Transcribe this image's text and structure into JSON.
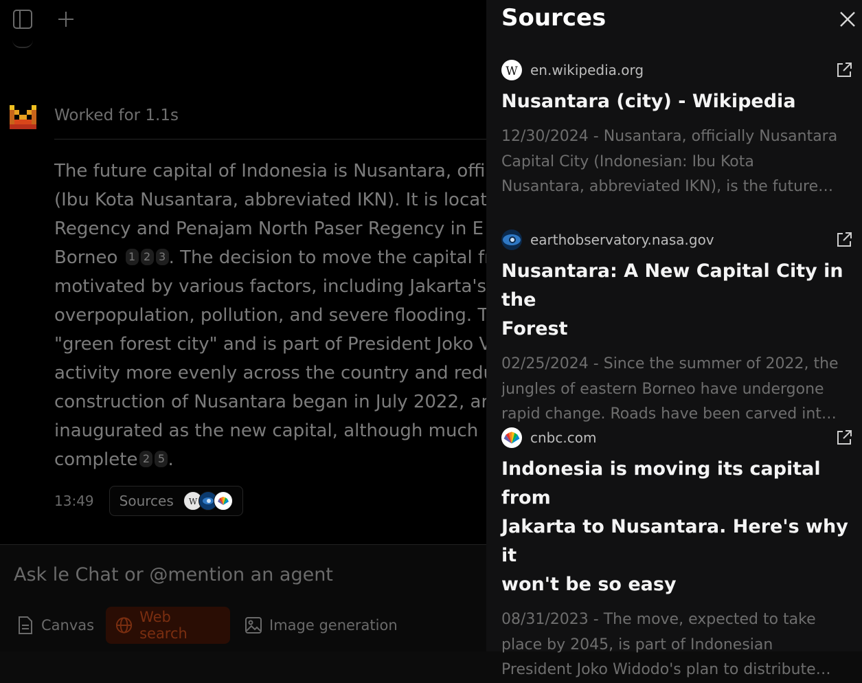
{
  "composer": {
    "placeholder": "Ask le Chat or @mention an agent",
    "tools": [
      {
        "label": "Canvas",
        "icon": "document-icon"
      },
      {
        "label": "Web search",
        "icon": "globe-icon",
        "active": true
      },
      {
        "label": "Image generation",
        "icon": "image-icon"
      }
    ]
  },
  "message": {
    "status": "Worked for 1.1s",
    "lines": [
      "The future capital of Indonesia is Nusantara, offi",
      "(Ibu Kota Nusantara, abbreviated IKN). It is locat",
      "Regency and Penajam North Paser Regency in E",
      "Borneo",
      ". The decision to move the capital fr",
      "motivated by various factors, including Jakarta's",
      "overpopulation, pollution, and severe flooding. T",
      "\"green forest city\" and is part of President Joko V",
      "activity more evenly across the country and redu",
      "construction of Nusantara began in July 2022, ar",
      "inaugurated as the new capital, although much",
      "complete",
      "."
    ],
    "citations_a": [
      "1",
      "2",
      "3"
    ],
    "citations_b": [
      "2",
      "5"
    ],
    "time": "13:49",
    "sources_label": "Sources"
  },
  "panel": {
    "title": "Sources",
    "sources": [
      {
        "domain": "en.wikipedia.org",
        "icon": "wikipedia-icon",
        "title_lines": [
          "Nusantara (city) - Wikipedia"
        ],
        "snippet_lines": [
          "12/30/2024 - Nusantara, officially Nusantara",
          "Capital City (Indonesian: Ibu Kota",
          "Nusantara, abbreviated IKN), is the future…"
        ]
      },
      {
        "domain": "earthobservatory.nasa.gov",
        "icon": "nasa-earth-observatory-icon",
        "title_lines": [
          "Nusantara: A New Capital City in the",
          "Forest"
        ],
        "snippet_lines": [
          "02/25/2024 - Since the summer of 2022, the",
          "jungles of eastern Borneo have undergone",
          "rapid change. Roads have been carved int…"
        ]
      },
      {
        "domain": "cnbc.com",
        "icon": "nbc-peacock-icon",
        "title_lines": [
          "Indonesia is moving its capital from",
          "Jakarta to Nusantara. Here's why it",
          "won't be so easy"
        ],
        "snippet_lines": [
          "08/31/2023 - The move, expected to take",
          "place by 2045, is part of Indonesian",
          "President Joko Widodo's plan to distribute…"
        ]
      }
    ]
  },
  "colors": {
    "accent": "#f0511a",
    "panel_bg": "#111112",
    "chat_bg": "#000000"
  }
}
